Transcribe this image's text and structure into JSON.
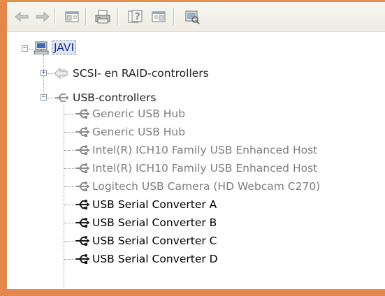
{
  "toolbar": {
    "buttons": [
      {
        "name": "back-button",
        "icon": "arrow-left-icon"
      },
      {
        "name": "forward-button",
        "icon": "arrow-right-icon"
      },
      {
        "name": "show-hide-console-tree-button",
        "icon": "console-tree-icon"
      },
      {
        "name": "print-button",
        "icon": "printer-icon"
      },
      {
        "name": "help-button",
        "icon": "help-icon"
      },
      {
        "name": "show-hide-action-pane-button",
        "icon": "action-pane-icon"
      },
      {
        "name": "scan-hardware-button",
        "icon": "scan-hardware-icon"
      }
    ]
  },
  "tree": {
    "root": {
      "label": "JAVI",
      "expanded": true
    },
    "categories": [
      {
        "label": "SCSI- en RAID-controllers",
        "expanded": false
      },
      {
        "label": "USB-controllers",
        "expanded": true
      }
    ],
    "usb_devices": [
      {
        "label": "Generic USB Hub",
        "style": "gray"
      },
      {
        "label": "Generic USB Hub",
        "style": "gray"
      },
      {
        "label": "Intel(R) ICH10 Family USB Enhanced Host",
        "style": "gray"
      },
      {
        "label": "Intel(R) ICH10 Family USB Enhanced Host",
        "style": "gray"
      },
      {
        "label": "Logitech USB Camera (HD Webcam C270)",
        "style": "gray"
      },
      {
        "label": "USB Serial Converter A",
        "style": "black"
      },
      {
        "label": "USB Serial Converter B",
        "style": "black"
      },
      {
        "label": "USB Serial Converter C",
        "style": "black"
      },
      {
        "label": "USB Serial Converter D",
        "style": "black"
      }
    ]
  },
  "colors": {
    "frame": "#e3874a",
    "toolbar": "#efede4",
    "selection": "#dfe6f8",
    "disabled_text": "#7e7e7e"
  }
}
